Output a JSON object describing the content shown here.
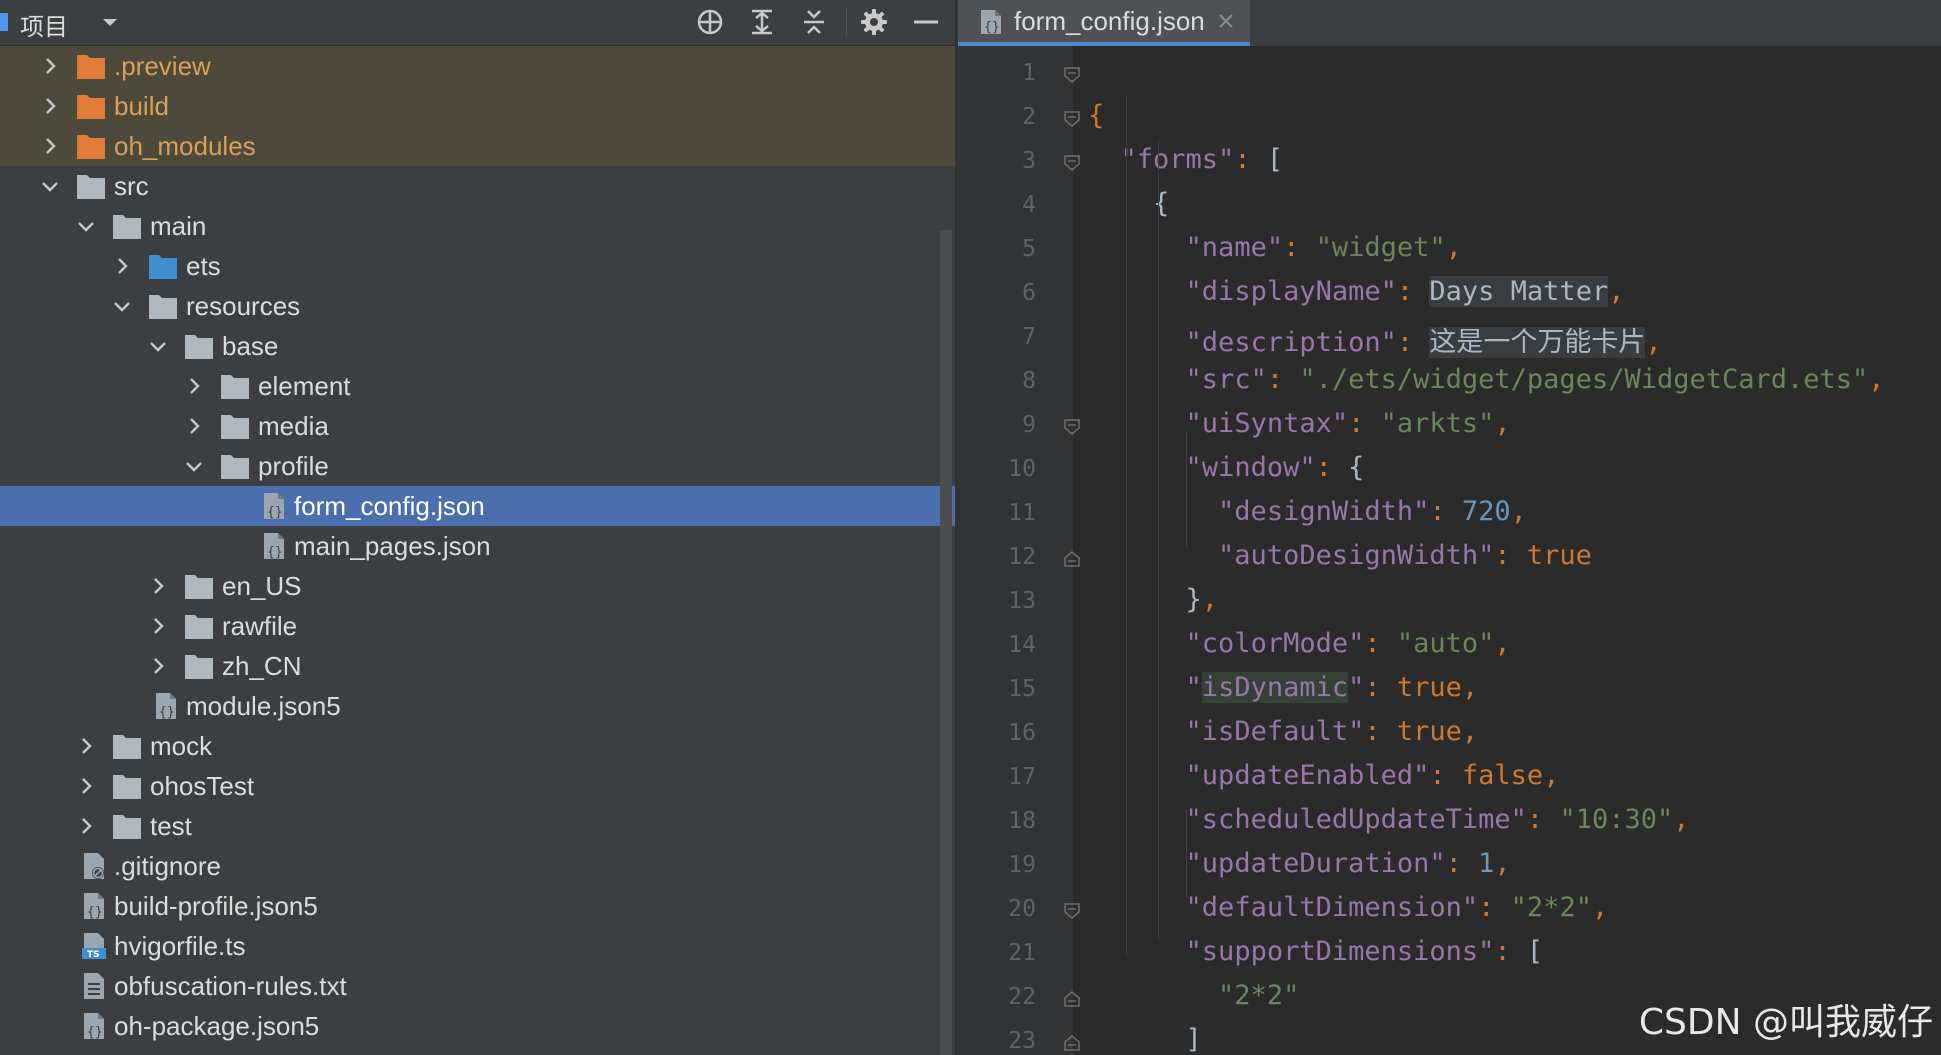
{
  "project_panel": {
    "title": "项目",
    "tree": [
      {
        "label": ".preview",
        "level": 0,
        "arrow": "right",
        "icon": "folder-orange",
        "state": "excluded"
      },
      {
        "label": "build",
        "level": 0,
        "arrow": "right",
        "icon": "folder-orange",
        "state": "excluded"
      },
      {
        "label": "oh_modules",
        "level": 0,
        "arrow": "right",
        "icon": "folder-orange",
        "state": "excluded"
      },
      {
        "label": "src",
        "level": 0,
        "arrow": "down",
        "icon": "folder",
        "state": "normal"
      },
      {
        "label": "main",
        "level": 1,
        "arrow": "down",
        "icon": "folder",
        "state": "normal"
      },
      {
        "label": "ets",
        "level": 2,
        "arrow": "right",
        "icon": "folder-blue",
        "state": "normal"
      },
      {
        "label": "resources",
        "level": 2,
        "arrow": "down",
        "icon": "folder",
        "state": "normal"
      },
      {
        "label": "base",
        "level": 3,
        "arrow": "down",
        "icon": "folder",
        "state": "normal"
      },
      {
        "label": "element",
        "level": 4,
        "arrow": "right",
        "icon": "folder",
        "state": "normal"
      },
      {
        "label": "media",
        "level": 4,
        "arrow": "right",
        "icon": "folder",
        "state": "normal"
      },
      {
        "label": "profile",
        "level": 4,
        "arrow": "down",
        "icon": "folder",
        "state": "normal"
      },
      {
        "label": "form_config.json",
        "level": 5,
        "arrow": "none",
        "icon": "json-file",
        "state": "selected"
      },
      {
        "label": "main_pages.json",
        "level": 5,
        "arrow": "none",
        "icon": "json-file",
        "state": "normal"
      },
      {
        "label": "en_US",
        "level": 3,
        "arrow": "right",
        "icon": "folder",
        "state": "normal"
      },
      {
        "label": "rawfile",
        "level": 3,
        "arrow": "right",
        "icon": "folder",
        "state": "normal"
      },
      {
        "label": "zh_CN",
        "level": 3,
        "arrow": "right",
        "icon": "folder",
        "state": "normal"
      },
      {
        "label": "module.json5",
        "level": 2,
        "arrow": "none",
        "icon": "json-file",
        "state": "normal"
      },
      {
        "label": "mock",
        "level": 1,
        "arrow": "right",
        "icon": "folder",
        "state": "normal"
      },
      {
        "label": "ohosTest",
        "level": 1,
        "arrow": "right",
        "icon": "folder",
        "state": "normal"
      },
      {
        "label": "test",
        "level": 1,
        "arrow": "right",
        "icon": "folder",
        "state": "normal"
      },
      {
        "label": ".gitignore",
        "level": 0,
        "arrow": "none",
        "icon": "gitignore-file",
        "state": "normal"
      },
      {
        "label": "build-profile.json5",
        "level": 0,
        "arrow": "none",
        "icon": "json-file",
        "state": "normal"
      },
      {
        "label": "hvigorfile.ts",
        "level": 0,
        "arrow": "none",
        "icon": "ts-file",
        "state": "normal"
      },
      {
        "label": "obfuscation-rules.txt",
        "level": 0,
        "arrow": "none",
        "icon": "text-file",
        "state": "normal"
      },
      {
        "label": "oh-package.json5",
        "level": 0,
        "arrow": "none",
        "icon": "json-file",
        "state": "normal"
      }
    ]
  },
  "editor": {
    "tab": {
      "title": "form_config.json",
      "active": true
    },
    "lines": [
      {
        "n": "1",
        "tokens": [
          [
            "p",
            "{"
          ]
        ]
      },
      {
        "n": "2",
        "tokens": [
          [
            "t",
            "  "
          ],
          [
            "k",
            "\"forms\""
          ],
          [
            "p",
            ": "
          ],
          [
            "t",
            "["
          ]
        ]
      },
      {
        "n": "3",
        "tokens": [
          [
            "t",
            "    {"
          ]
        ]
      },
      {
        "n": "4",
        "tokens": [
          [
            "t",
            "      "
          ],
          [
            "k",
            "\"name\""
          ],
          [
            "p",
            ": "
          ],
          [
            "s",
            "\"widget\""
          ],
          [
            "p",
            ","
          ]
        ]
      },
      {
        "n": "5",
        "tokens": [
          [
            "t",
            "      "
          ],
          [
            "k",
            "\"displayName\""
          ],
          [
            "p",
            ": "
          ],
          [
            "hl",
            "Days Matter"
          ],
          [
            "p",
            ","
          ]
        ]
      },
      {
        "n": "6",
        "tokens": [
          [
            "t",
            "      "
          ],
          [
            "k",
            "\"description\""
          ],
          [
            "p",
            ": "
          ],
          [
            "hl",
            "这是一个万能卡片"
          ],
          [
            "p",
            ","
          ]
        ]
      },
      {
        "n": "7",
        "tokens": [
          [
            "t",
            "      "
          ],
          [
            "k",
            "\"src\""
          ],
          [
            "p",
            ": "
          ],
          [
            "s",
            "\"./ets/widget/pages/WidgetCard.ets\""
          ],
          [
            "p",
            ","
          ]
        ]
      },
      {
        "n": "8",
        "tokens": [
          [
            "t",
            "      "
          ],
          [
            "k",
            "\"uiSyntax\""
          ],
          [
            "p",
            ": "
          ],
          [
            "s",
            "\"arkts\""
          ],
          [
            "p",
            ","
          ]
        ]
      },
      {
        "n": "9",
        "tokens": [
          [
            "t",
            "      "
          ],
          [
            "k",
            "\"window\""
          ],
          [
            "p",
            ": "
          ],
          [
            "t",
            "{"
          ]
        ]
      },
      {
        "n": "10",
        "tokens": [
          [
            "t",
            "        "
          ],
          [
            "k",
            "\"designWidth\""
          ],
          [
            "p",
            ": "
          ],
          [
            "n",
            "720"
          ],
          [
            "p",
            ","
          ]
        ]
      },
      {
        "n": "11",
        "tokens": [
          [
            "t",
            "        "
          ],
          [
            "k",
            "\"autoDesignWidth\""
          ],
          [
            "p",
            ": "
          ],
          [
            "b",
            "true"
          ]
        ]
      },
      {
        "n": "12",
        "tokens": [
          [
            "t",
            "      }"
          ],
          [
            "p",
            ","
          ]
        ]
      },
      {
        "n": "13",
        "tokens": [
          [
            "t",
            "      "
          ],
          [
            "k",
            "\"colorMode\""
          ],
          [
            "p",
            ": "
          ],
          [
            "s",
            "\"auto\""
          ],
          [
            "p",
            ","
          ]
        ]
      },
      {
        "n": "14",
        "tokens": [
          [
            "t",
            "      "
          ],
          [
            "k",
            "\""
          ],
          [
            "kg",
            "isDynamic"
          ],
          [
            "k",
            "\""
          ],
          [
            "p",
            ": "
          ],
          [
            "b",
            "true"
          ],
          [
            "p",
            ","
          ]
        ]
      },
      {
        "n": "15",
        "tokens": [
          [
            "t",
            "      "
          ],
          [
            "k",
            "\"isDefault\""
          ],
          [
            "p",
            ": "
          ],
          [
            "b",
            "true"
          ],
          [
            "p",
            ","
          ]
        ]
      },
      {
        "n": "16",
        "tokens": [
          [
            "t",
            "      "
          ],
          [
            "k",
            "\"updateEnabled\""
          ],
          [
            "p",
            ": "
          ],
          [
            "b",
            "false"
          ],
          [
            "p",
            ","
          ]
        ]
      },
      {
        "n": "17",
        "tokens": [
          [
            "t",
            "      "
          ],
          [
            "k",
            "\"scheduledUpdateTime\""
          ],
          [
            "p",
            ": "
          ],
          [
            "s",
            "\"10:30\""
          ],
          [
            "p",
            ","
          ]
        ]
      },
      {
        "n": "18",
        "tokens": [
          [
            "t",
            "      "
          ],
          [
            "k",
            "\"updateDuration\""
          ],
          [
            "p",
            ": "
          ],
          [
            "n",
            "1"
          ],
          [
            "p",
            ","
          ]
        ]
      },
      {
        "n": "19",
        "tokens": [
          [
            "t",
            "      "
          ],
          [
            "k",
            "\"defaultDimension\""
          ],
          [
            "p",
            ": "
          ],
          [
            "s",
            "\"2*2\""
          ],
          [
            "p",
            ","
          ]
        ]
      },
      {
        "n": "20",
        "tokens": [
          [
            "t",
            "      "
          ],
          [
            "k",
            "\"supportDimensions\""
          ],
          [
            "p",
            ": "
          ],
          [
            "t",
            "["
          ]
        ]
      },
      {
        "n": "21",
        "tokens": [
          [
            "t",
            "        "
          ],
          [
            "s",
            "\"2*2\""
          ]
        ]
      },
      {
        "n": "22",
        "tokens": [
          [
            "t",
            "      ]"
          ]
        ]
      },
      {
        "n": "23",
        "tokens": [
          [
            "t",
            "    }"
          ],
          [
            "p",
            ","
          ]
        ]
      }
    ]
  },
  "watermark": "CSDN @叫我威仔",
  "colors": {
    "panel_bg": "#3c3f41",
    "editor_bg": "#2b2b2b",
    "selection": "#4b6eaf",
    "excluded_bg": "#4d4a3c",
    "key_purple": "#9876aa",
    "string_green": "#6a8759",
    "keyword_orange": "#cc7832",
    "number_blue": "#6897bb"
  }
}
